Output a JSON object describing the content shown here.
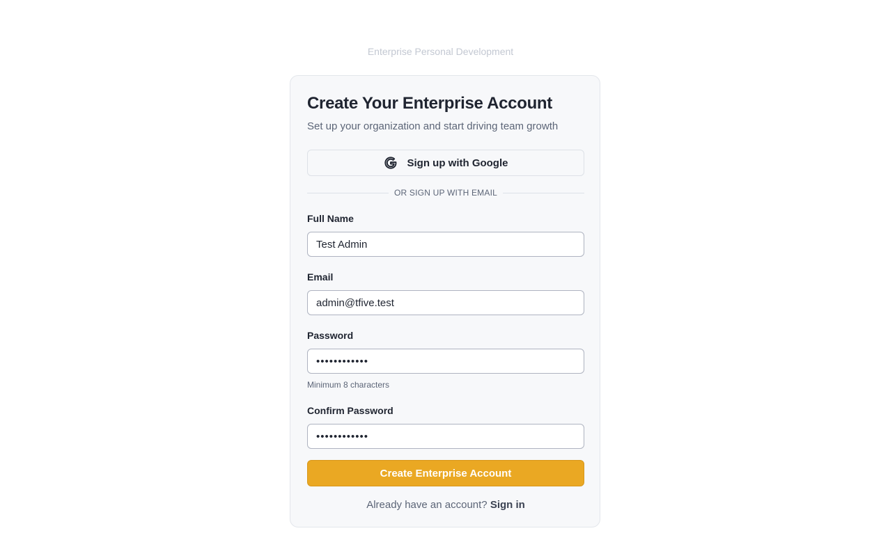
{
  "brand": {
    "name": "Enterprise Personal Development"
  },
  "card": {
    "title": "Create Your Enterprise Account",
    "subtitle": "Set up your organization and start driving team growth"
  },
  "google_button": {
    "icon": "google-icon",
    "label": "Sign up with Google"
  },
  "divider": {
    "text": "OR SIGN UP WITH EMAIL"
  },
  "form": {
    "full_name": {
      "label": "Full Name",
      "value": "Test Admin"
    },
    "email": {
      "label": "Email",
      "value": "admin@tfive.test"
    },
    "password": {
      "label": "Password",
      "value": "••••••••••••",
      "hint": "Minimum 8 characters"
    },
    "confirm_password": {
      "label": "Confirm Password",
      "value": "••••••••••••"
    }
  },
  "submit": {
    "label": "Create Enterprise Account"
  },
  "footer": {
    "prompt": "Already have an account?",
    "link_label": "Sign in"
  },
  "colors": {
    "accent": "#eaa823",
    "card_background": "#f7f8fa",
    "text_primary": "#1f2430",
    "text_muted": "#5c6577"
  }
}
